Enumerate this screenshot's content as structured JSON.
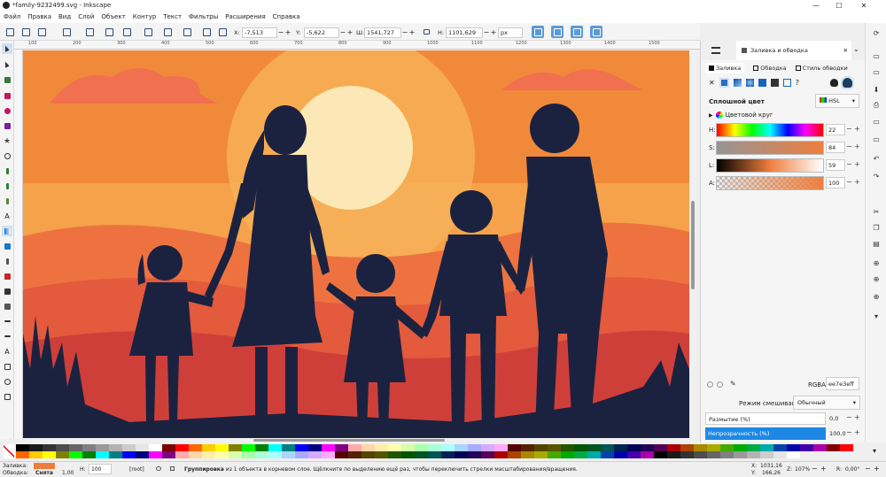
{
  "window": {
    "title": "*family-9232499.svg - Inkscape",
    "minimize": "—",
    "maximize": "☐",
    "close": "✕"
  },
  "menu": [
    "Файл",
    "Правка",
    "Вид",
    "Слой",
    "Объект",
    "Контур",
    "Текст",
    "Фильтры",
    "Расширения",
    "Справка"
  ],
  "toolbar": {
    "x_label": "X:",
    "x_value": "-7,513",
    "y_label": "Y:",
    "y_value": "-5,622",
    "w_label": "Ш:",
    "w_value": "1541,727",
    "h_label": "H:",
    "h_value": "1101,629",
    "unit": "px"
  },
  "ruler": {
    "ticks": [
      "100",
      "200",
      "300",
      "400",
      "500",
      "600",
      "700",
      "800",
      "900",
      "1000",
      "1100",
      "1200",
      "1300",
      "1400",
      "1500"
    ]
  },
  "panel": {
    "header_title": "Заливка и обводка",
    "tabs": [
      "Заливка",
      "Обводка",
      "Стиль обводки"
    ],
    "paint_mode": "Сплошной цвет",
    "color_model": "HSL",
    "wheel_label": "Цветовой круг",
    "channels": [
      {
        "label": "H:",
        "value": "22"
      },
      {
        "label": "S:",
        "value": "84"
      },
      {
        "label": "L:",
        "value": "59"
      },
      {
        "label": "A:",
        "value": "100"
      }
    ],
    "rgba_label": "RGBA:",
    "rgba_value": "ee7e3eff",
    "blend_label": "Режим смешивания:",
    "blend_value": "Обычный",
    "blur_label": "Размытие (%)",
    "blur_value": "0,0",
    "opacity_label": "Непрозрачность (%)",
    "opacity_value": "100,0"
  },
  "status": {
    "fill_label": "Заливка:",
    "stroke_label": "Обводка:",
    "stroke_value": "Снята",
    "stroke_width": "1,00",
    "h_label": "H:",
    "h_value": "100",
    "layer": "[root]",
    "message_bold": "Группировка",
    "message_rest": " из 1 объекта в корневом слое. Щёлкните по выделению ещё раз, чтобы переключить стрелки масштабирования/вращения.",
    "coord_x_label": "X:",
    "coord_x": "1031,16",
    "coord_y_label": "Y:",
    "coord_y": "166,26",
    "zoom_label": "Z:",
    "zoom": "107%",
    "rotate_label": "R:",
    "rotate": "0,00°"
  },
  "colors": {
    "fill": "#ee7e3e",
    "selected": "#1e88e5",
    "toolbar_accent": "#5b9bd5"
  },
  "palette": [
    "#000000",
    "#1a1a1a",
    "#333333",
    "#4d4d4d",
    "#666666",
    "#808080",
    "#999999",
    "#b3b3b3",
    "#cccccc",
    "#e6e6e6",
    "#ffffff",
    "#800000",
    "#ff0000",
    "#ff6600",
    "#ffcc00",
    "#ffff00",
    "#808000",
    "#00ff00",
    "#008000",
    "#00ffff",
    "#008080",
    "#0000ff",
    "#000080",
    "#ff00ff",
    "#800080",
    "#ffaaaa",
    "#ffd5aa",
    "#ffeeaa",
    "#ffffaa",
    "#d5ffaa",
    "#aaffaa",
    "#aaffd5",
    "#aaffff",
    "#aad5ff",
    "#aaaaff",
    "#d5aaff",
    "#ffaaff",
    "#550000",
    "#552200",
    "#554400",
    "#555500",
    "#225500",
    "#005500",
    "#005522",
    "#005555",
    "#002255",
    "#000055",
    "#220055",
    "#550055",
    "#aa0000",
    "#aa4400",
    "#aa8800",
    "#aaaa00",
    "#44aa00",
    "#00aa00",
    "#00aa44",
    "#00aaaa",
    "#0044aa",
    "#0000aa",
    "#4400aa",
    "#aa00aa"
  ]
}
